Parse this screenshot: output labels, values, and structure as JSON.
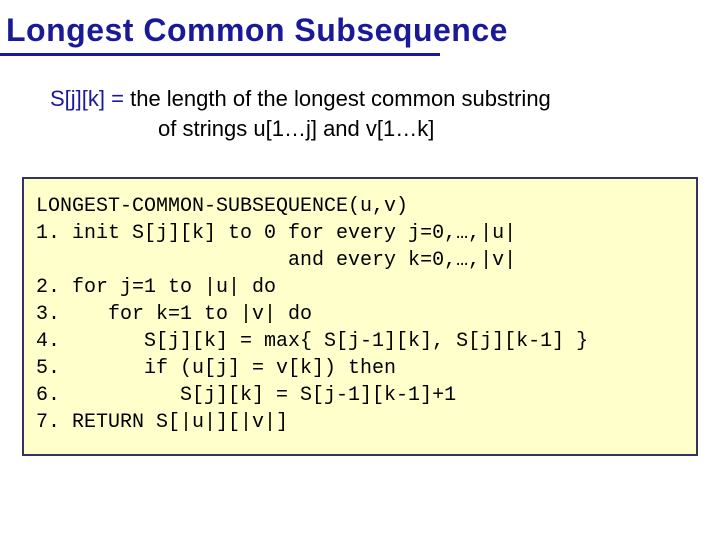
{
  "title": "Longest Common Subsequence",
  "definition": {
    "lhs": "S[j][k] =",
    "rhs_line1": " the length of the longest common substring",
    "rhs_line2": "of strings u[1…j] and v[1…k]"
  },
  "code": {
    "header": "LONGEST-COMMON-SUBSEQUENCE(u,v)",
    "line1": "1. init S[j][k] to 0 for every j=0,…,|u|",
    "line1b": "                     and every k=0,…,|v|",
    "line2": "2. for j=1 to |u| do",
    "line3": "3.    for k=1 to |v| do",
    "line4": "4.       S[j][k] = max{ S[j-1][k], S[j][k-1] }",
    "line5": "5.       if (u[j] = v[k]) then",
    "line6": "6.          S[j][k] = S[j-1][k-1]+1",
    "line7": "7. RETURN S[|u|][|v|]"
  }
}
